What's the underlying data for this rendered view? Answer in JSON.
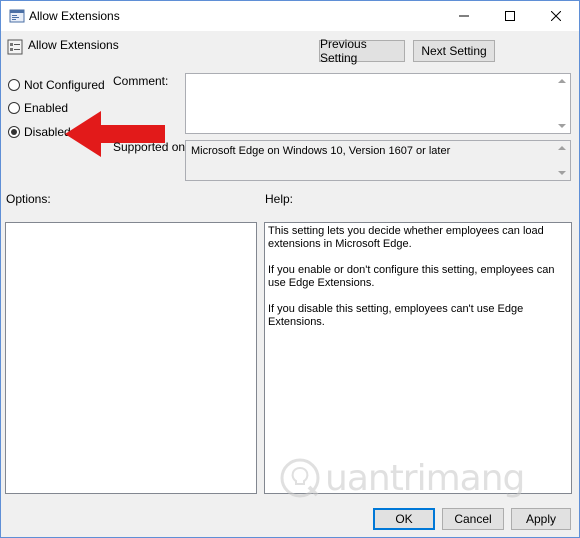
{
  "window": {
    "title": "Allow Extensions"
  },
  "header": {
    "setting_name": "Allow Extensions",
    "prev_button": "Previous Setting",
    "next_button": "Next Setting"
  },
  "state": {
    "options": [
      {
        "label": "Not Configured",
        "selected": false
      },
      {
        "label": "Enabled",
        "selected": false
      },
      {
        "label": "Disabled",
        "selected": true
      }
    ]
  },
  "comment": {
    "label": "Comment:",
    "value": ""
  },
  "supported": {
    "label": "Supported on:",
    "value": "Microsoft Edge on Windows 10, Version 1607 or later"
  },
  "options_pane": {
    "label": "Options:"
  },
  "help_pane": {
    "label": "Help:",
    "paragraphs": [
      "This setting lets you decide whether employees can load extensions in Microsoft Edge.",
      "If you enable or don't configure this setting, employees can use Edge Extensions.",
      "If you disable this setting, employees can't use Edge Extensions."
    ]
  },
  "footer": {
    "ok": "OK",
    "cancel": "Cancel",
    "apply": "Apply"
  },
  "watermark": {
    "text": "uantrimang"
  },
  "colors": {
    "arrow": "#e21a1a",
    "accent": "#0078d7"
  }
}
